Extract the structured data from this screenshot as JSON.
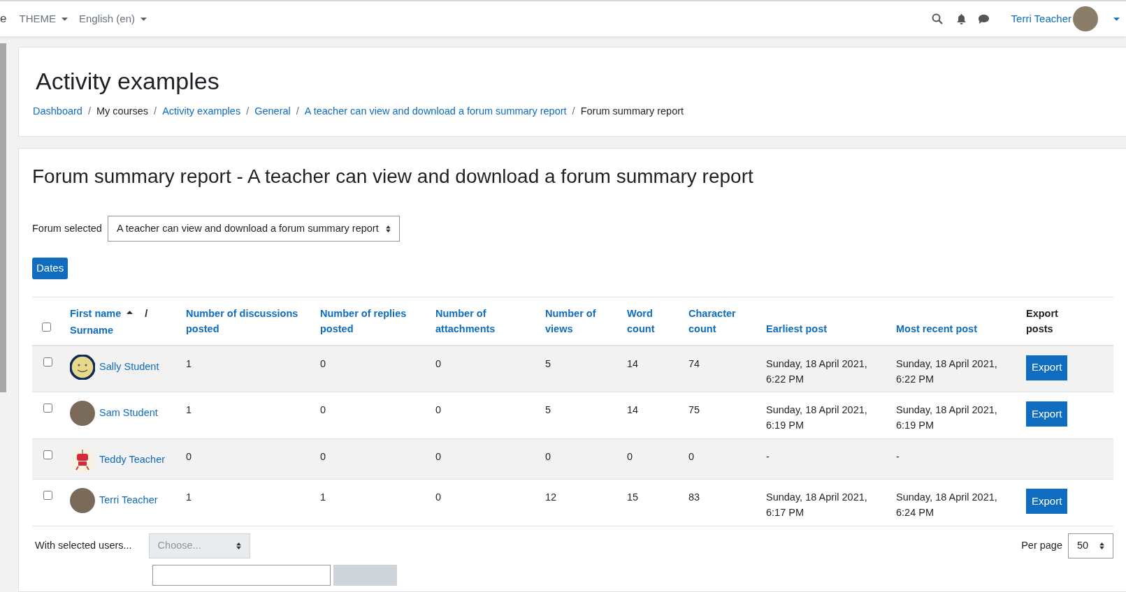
{
  "navbar": {
    "site_name_fragment": "e",
    "menus": [
      {
        "label": "THEME"
      },
      {
        "label": "English (en)"
      }
    ],
    "user": {
      "name": "Terri Teacher"
    }
  },
  "header": {
    "title": "Activity examples",
    "separator": "/",
    "breadcrumbs": [
      {
        "label": "Dashboard",
        "link": true
      },
      {
        "label": "My courses",
        "link": false
      },
      {
        "label": "Activity examples",
        "link": true
      },
      {
        "label": "General",
        "link": true
      },
      {
        "label": "A teacher can view and download a forum summary report",
        "link": true
      },
      {
        "label": "Forum summary report",
        "link": false
      }
    ]
  },
  "report": {
    "title": "Forum summary report - A teacher can view and download a forum summary report",
    "forum_label": "Forum selected",
    "forum_value": "A teacher can view and download a forum summary report",
    "dates_button": "Dates",
    "table": {
      "select_all_checked": false,
      "name_column": {
        "first": "First name",
        "separator": "/",
        "second": "Surname",
        "sorted_ascending": true
      },
      "columns": [
        {
          "label": "Number of discussions posted",
          "link": true
        },
        {
          "label": "Number of replies posted",
          "link": true
        },
        {
          "label": "Number of attachments",
          "link": true
        },
        {
          "label": "Number of views",
          "link": true
        },
        {
          "label": "Word count",
          "link": true
        },
        {
          "label": "Character count",
          "link": true
        },
        {
          "label": "Earliest post",
          "link": true
        },
        {
          "label": "Most recent post",
          "link": true
        },
        {
          "label": "Export posts",
          "link": false
        }
      ],
      "rows": [
        {
          "checked": false,
          "avatar": {
            "kind": "smiley"
          },
          "name": "Sally Student",
          "cells": [
            "1",
            "0",
            "0",
            "5",
            "14",
            "74",
            "Sunday, 18 April 2021, 6:22 PM",
            "Sunday, 18 April 2021, 6:22 PM"
          ],
          "export": "Export"
        },
        {
          "checked": false,
          "avatar": {
            "kind": "photo"
          },
          "name": "Sam Student",
          "cells": [
            "1",
            "0",
            "0",
            "5",
            "14",
            "75",
            "Sunday, 18 April 2021, 6:19 PM",
            "Sunday, 18 April 2021, 6:19 PM"
          ],
          "export": "Export"
        },
        {
          "checked": false,
          "avatar": {
            "kind": "robot"
          },
          "name": "Teddy Teacher",
          "cells": [
            "0",
            "0",
            "0",
            "0",
            "0",
            "0",
            "-",
            "-"
          ]
        },
        {
          "checked": false,
          "avatar": {
            "kind": "photo"
          },
          "name": "Terri Teacher",
          "cells": [
            "1",
            "1",
            "0",
            "12",
            "15",
            "83",
            "Sunday, 18 April 2021, 6:17 PM",
            "Sunday, 18 April 2021, 6:24 PM"
          ],
          "export": "Export"
        }
      ]
    },
    "bulk": {
      "label": "With selected users...",
      "placeholder": "Choose...",
      "disabled": true
    },
    "per_page": {
      "label": "Per page",
      "value": "50"
    }
  }
}
